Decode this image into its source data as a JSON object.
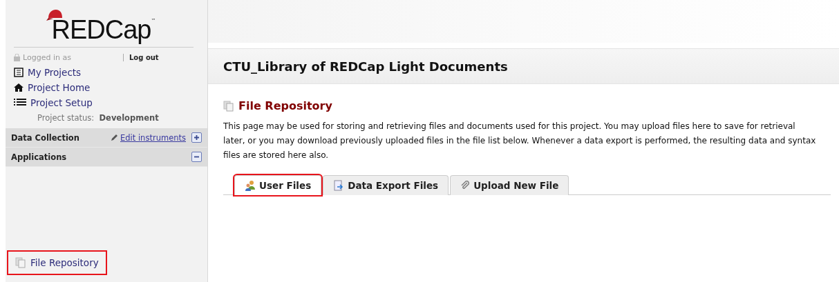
{
  "logo": {
    "text": "REDCap",
    "mark": "™"
  },
  "user": {
    "logged_in": "Logged in as",
    "logout": "Log out"
  },
  "nav": [
    {
      "label": "My Projects",
      "kind": "list"
    },
    {
      "label": "Project Home",
      "kind": "home"
    },
    {
      "label": "Project Setup",
      "kind": "setup"
    }
  ],
  "project_status": {
    "label": "Project status:",
    "value": "Development"
  },
  "sections": [
    {
      "title": "Data Collection",
      "link": "Edit instruments",
      "expanded": false
    },
    {
      "title": "Applications",
      "expanded": true
    }
  ],
  "applications": [
    {
      "label": "File Repository",
      "highlighted": true
    }
  ],
  "project_title": "CTU_Library of REDCap Light Documents",
  "page": {
    "title": "File Repository",
    "description": "This page may be used for storing and retrieving files and documents used for this project. You may upload files here to save for retrieval later, or you may download previously uploaded files in the file list below. Whenever a data export is performed, the resulting data and syntax files are stored here also."
  },
  "tabs": [
    {
      "label": "User Files",
      "kind": "users",
      "selected": true,
      "highlighted": true
    },
    {
      "label": "Data Export Files",
      "kind": "export",
      "selected": false,
      "highlighted": false
    },
    {
      "label": "Upload New File",
      "kind": "clip",
      "selected": false,
      "highlighted": false
    }
  ]
}
